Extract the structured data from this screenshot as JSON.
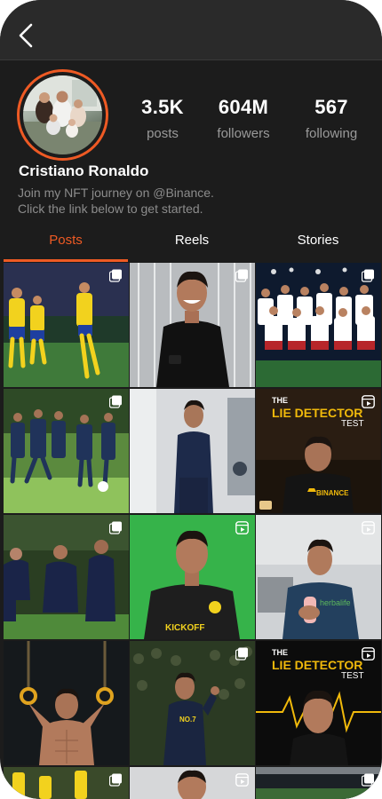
{
  "profile": {
    "name": "Cristiano Ronaldo",
    "bio_line1": "Join my NFT journey on @Binance.",
    "bio_line2": "Click the link below to get started.",
    "posts_count": "3.5K",
    "posts_label": "posts",
    "followers_count": "604M",
    "followers_label": "followers",
    "following_count": "567",
    "following_label": "following"
  },
  "tabs": [
    {
      "label": "Posts"
    },
    {
      "label": "Reels"
    },
    {
      "label": "Stories"
    }
  ],
  "grid": {
    "lie_the": "THE",
    "lie_title": "LIE DETECTOR",
    "lie_test": "TEST",
    "binance": "BINANCE",
    "kickoff": "KICKOFF",
    "herbalife": "herbalife",
    "jersey": "NO.7"
  },
  "colors": {
    "accent": "#ee5a24",
    "background": "#1c1c1c",
    "topbar": "#2a2a2a"
  }
}
